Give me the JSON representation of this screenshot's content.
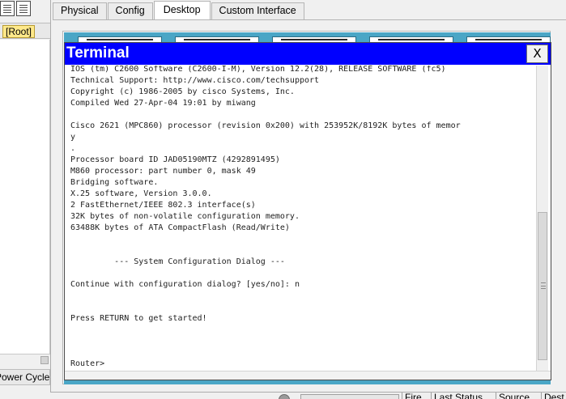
{
  "tabs": [
    {
      "label": "Physical",
      "active": false
    },
    {
      "label": "Config",
      "active": false
    },
    {
      "label": "Desktop",
      "active": true
    },
    {
      "label": "Custom Interface",
      "active": false
    }
  ],
  "left_panel": {
    "root_label": "[Root]",
    "power_cycle_label": "Power Cycle Devices"
  },
  "terminal": {
    "title": "Terminal",
    "close_label": "X",
    "lines": [
      "IOS (tm) C2600 Software (C2600-I-M), Version 12.2(28), RELEASE SOFTWARE (fc5)",
      "Technical Support: http://www.cisco.com/techsupport",
      "Copyright (c) 1986-2005 by cisco Systems, Inc.",
      "Compiled Wed 27-Apr-04 19:01 by miwang",
      "",
      "Cisco 2621 (MPC860) processor (revision 0x200) with 253952K/8192K bytes of memor",
      "y",
      ".",
      "Processor board ID JAD05190MTZ (4292891495)",
      "M860 processor: part number 0, mask 49",
      "Bridging software.",
      "X.25 software, Version 3.0.0.",
      "2 FastEthernet/IEEE 802.3 interface(s)",
      "32K bytes of non-volatile configuration memory.",
      "63488K bytes of ATA CompactFlash (Read/Write)",
      "",
      "",
      "         --- System Configuration Dialog ---",
      "",
      "Continue with configuration dialog? [yes/no]: n",
      "",
      "",
      "Press RETURN to get started!",
      "",
      "",
      "",
      "Router>"
    ]
  },
  "bottom_columns": [
    "Fire",
    "Last Status",
    "Source",
    "Dest"
  ]
}
